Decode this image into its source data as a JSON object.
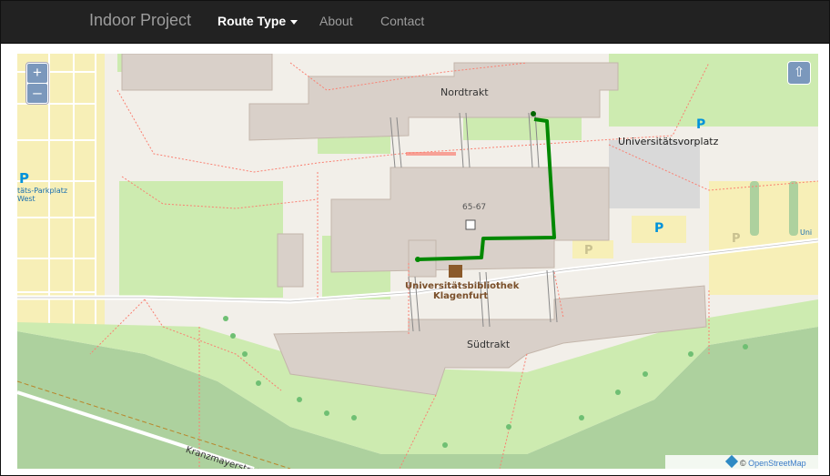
{
  "navbar": {
    "brand": "Indoor Project",
    "items": [
      {
        "label": "Route Type",
        "active": true
      },
      {
        "label": "About",
        "active": false
      },
      {
        "label": "Contact",
        "active": false
      }
    ]
  },
  "map": {
    "zoom_in": "+",
    "zoom_out": "–",
    "labels": {
      "nordtrakt": "Nordtrakt",
      "universitaetsvorplatz": "Universitätsvorplatz",
      "building_number": "65-67",
      "library_line1": "Universitätsbibliothek",
      "library_line2": "Klagenfurt",
      "suedtrakt": "Südtrakt",
      "parking_line1": "täts-Parkplatz",
      "parking_line2": "West",
      "right_edge_label": "Uni",
      "street": "Kranzmayerstraße"
    },
    "parking_symbol": "P",
    "attribution": {
      "prefix": "©",
      "link": "OpenStreetMap"
    },
    "colors": {
      "route": "#008800",
      "map_bg": "#f2efe9",
      "grass": "#cdebb0",
      "forest": "#add19e",
      "building": "#d9d0c9",
      "parking": "#f7efb7"
    }
  }
}
